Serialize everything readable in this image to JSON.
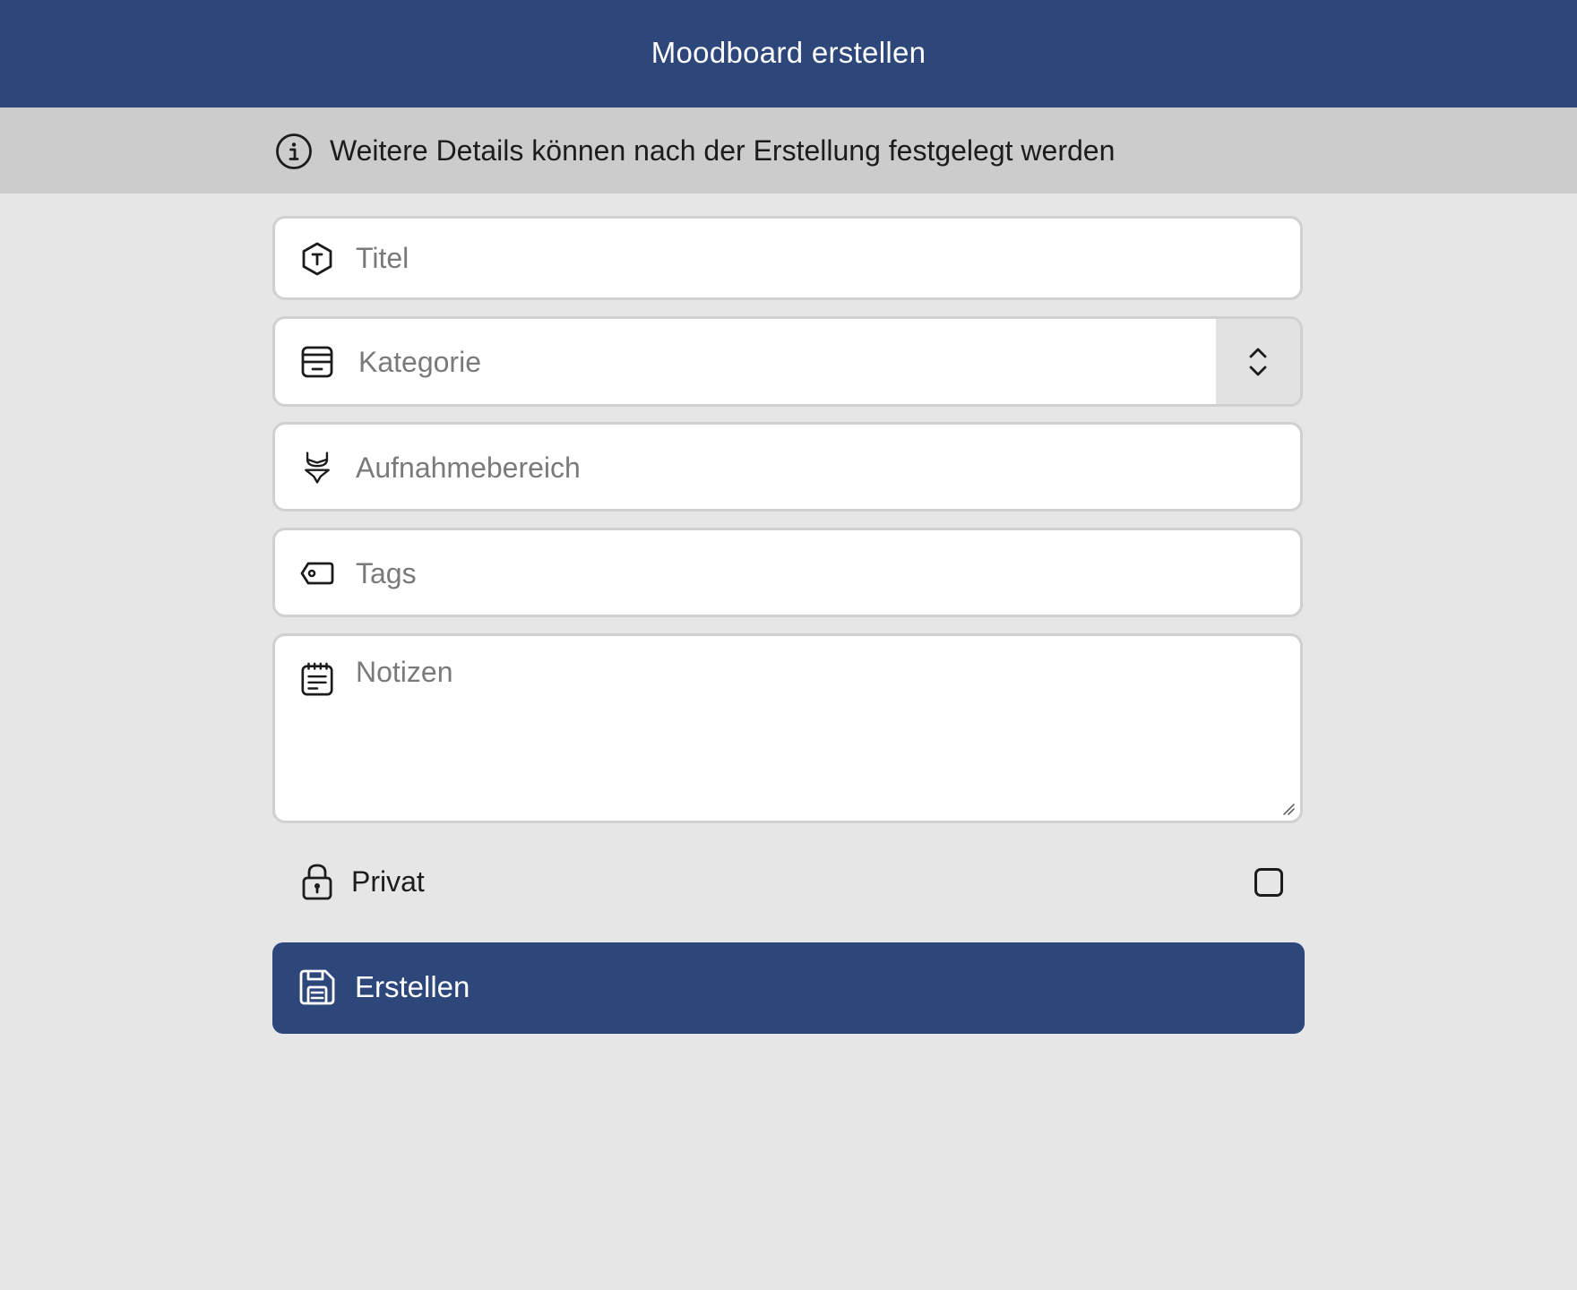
{
  "header": {
    "title": "Moodboard erstellen"
  },
  "info_banner": {
    "icon": "info-icon",
    "text": "Weitere Details können nach der Erstellung festgelegt werden"
  },
  "form": {
    "title_field": {
      "icon": "title-icon",
      "placeholder": "Titel",
      "value": ""
    },
    "category_field": {
      "icon": "archive-icon",
      "placeholder": "Kategorie",
      "value": "",
      "stepper_icon": "chevron-up-down-icon"
    },
    "area_field": {
      "icon": "bikini-icon",
      "placeholder": "Aufnahmebereich",
      "value": ""
    },
    "tags_field": {
      "icon": "tag-icon",
      "placeholder": "Tags",
      "value": ""
    },
    "notes_field": {
      "icon": "notes-icon",
      "placeholder": "Notizen",
      "value": ""
    },
    "private": {
      "icon": "lock-icon",
      "label": "Privat",
      "checked": false
    },
    "create_button": {
      "icon": "save-icon",
      "label": "Erstellen"
    }
  },
  "colors": {
    "primary": "#2d477b",
    "background": "#e6e6e6",
    "banner": "#cccccc",
    "field_border": "#d0d0d0"
  }
}
